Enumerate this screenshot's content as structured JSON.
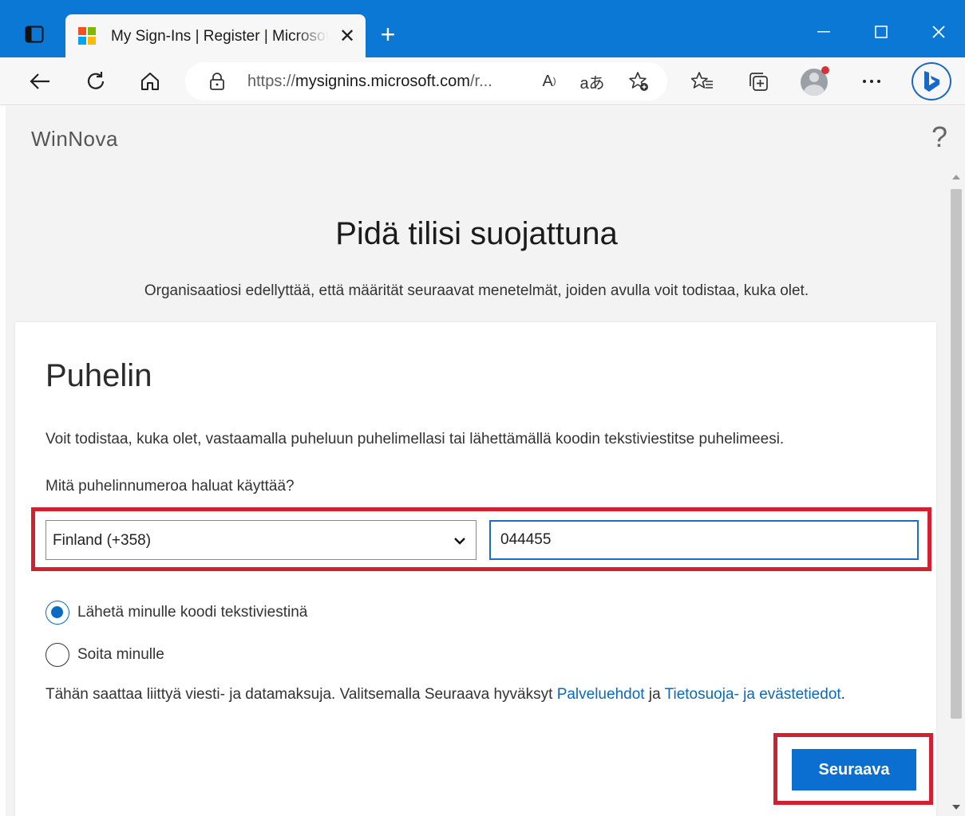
{
  "browser": {
    "tab_title": "My Sign-Ins | Register | Microsoft",
    "tab_close": "✕",
    "new_tab": "+",
    "url_prefix": "https://",
    "url_host": "mysignins.microsoft.com",
    "url_rest": "/r...",
    "read_aloud": "A",
    "translate": "aあ"
  },
  "app": {
    "brand": "WinNova",
    "help": "?"
  },
  "page": {
    "title": "Pidä tilisi suojattuna",
    "subtitle": "Organisaatiosi edellyttää, että määrität seuraavat menetelmät, joiden avulla voit todistaa, kuka olet."
  },
  "card": {
    "heading": "Puhelin",
    "description": "Voit todistaa, kuka olet, vastaamalla puheluun puhelimellasi tai lähettämällä koodin tekstiviestitse puhelimeesi.",
    "question": "Mitä puhelinnumeroa haluat käyttää?",
    "country_selected": "Finland (+358)",
    "phone_value": "044455",
    "options": [
      {
        "label": "Lähetä minulle koodi tekstiviestinä",
        "checked": true
      },
      {
        "label": "Soita minulle",
        "checked": false
      }
    ],
    "terms_text": "Tähän saattaa liittyä viesti- ja datamaksuja. Valitsemalla Seuraava hyväksyt ",
    "terms_link": "Palveluehdot",
    "terms_and": " ja ",
    "privacy_link": "Tietosuoja- ja evästetiedot",
    "terms_end": ".",
    "next_label": "Seuraava"
  },
  "colors": {
    "titlebar": "#0b78d6",
    "accent": "#0b6fd1",
    "link": "#0b69b7",
    "highlight": "#d1202f"
  }
}
